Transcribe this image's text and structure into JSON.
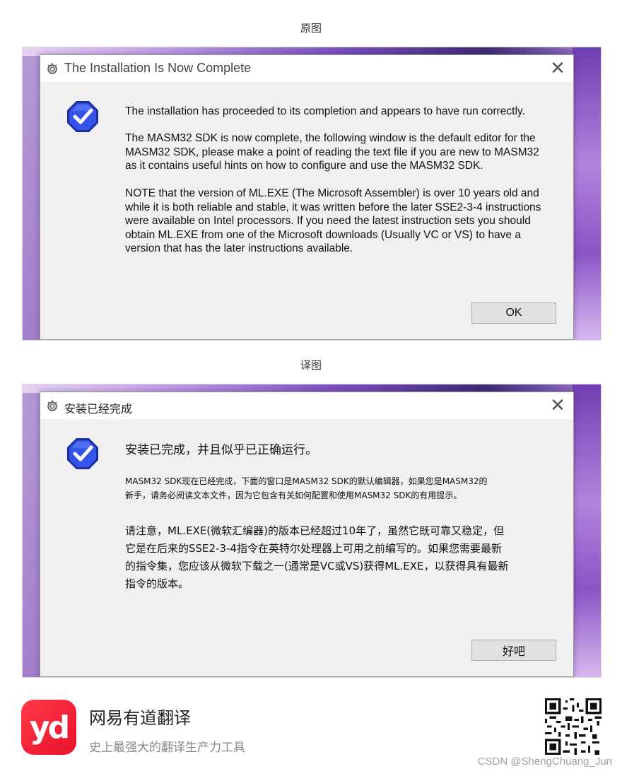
{
  "original": {
    "caption": "原图",
    "dialog": {
      "title": "The Installation Is Now Complete",
      "close_glyph": "✕",
      "paragraphs": [
        "The installation has proceeded to its completion and appears to have run correctly.",
        "The MASM32 SDK is now complete, the following window is the default editor for the\nMASM32 SDK, please make a point of reading the text file if you are new to MASM32\nas it contains useful hints on how to configure and use the MASM32 SDK.",
        "NOTE that the version of ML.EXE (The Microsoft Assembler) is over 10 years old and\nwhile it is both reliable and stable, it was written before the later SSE2-3-4 instructions\nwere available on Intel processors. If you need the latest instruction sets you should\nobtain ML.EXE from one of the Microsoft downloads (Usually VC or VS) to have a\nversion that has the later instructions available."
      ],
      "ok_label": "OK"
    }
  },
  "translated": {
    "caption": "译图",
    "dialog": {
      "title": "安装已经完成",
      "close_glyph": "✕",
      "paragraphs": [
        "安装已完成，并且似乎已正确运行。",
        "MASM32 SDK现在已经完成，下面的窗口是MASM32 SDK的默认编辑器，如果您是MASM32的\n新手，请务必阅读文本文件，因为它包含有关如何配置和使用MASM32 SDK的有用提示。",
        "请注意，ML.EXE(微软汇编器)的版本已经超过10年了，虽然它既可靠又稳定，但\n它是在后来的SSE2-3-4指令在英特尔处理器上可用之前编写的。如果您需要最新\n的指令集，您应该从微软下载之一(通常是VC或VS)获得ML.EXE，以获得具有最新\n指令的版本。"
      ],
      "ok_label": "好吧"
    }
  },
  "footer": {
    "logo_text": "yd",
    "brand_name": "网易有道翻译",
    "slogan": "史上最强大的翻译生产力工具",
    "watermark": "CSDN @ShengChuang_Jun"
  },
  "icons": {
    "title_icon": "installer-gear-icon",
    "message_icon": "checkmark-octagon-icon",
    "qr": "qr-code"
  },
  "colors": {
    "dialog_bg": "#f0f0f0",
    "check_blue": "#2a3fd6",
    "logo_red": "#e8102a"
  }
}
